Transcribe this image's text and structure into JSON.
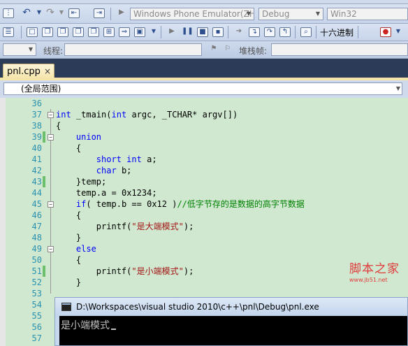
{
  "toolbar": {
    "platform_combo": "Windows Phone Emulator(ZH-",
    "config_combo": "Debug",
    "arch_combo": "Win32",
    "hex_label": "十六进制"
  },
  "debugbar": {
    "thread_label": "线程:",
    "stack_label": "堆栈帧:"
  },
  "tab": {
    "filename": "pnl.cpp",
    "close": "×"
  },
  "navbar": {
    "scope": "(全局范围)"
  },
  "editor": {
    "lines": [
      {
        "n": "36",
        "text": ""
      },
      {
        "n": "37",
        "text": "int _tmain(int argc, _TCHAR* argv[])"
      },
      {
        "n": "38",
        "text": "{"
      },
      {
        "n": "39",
        "text": "    union"
      },
      {
        "n": "40",
        "text": "    {"
      },
      {
        "n": "41",
        "text": "        short int a;"
      },
      {
        "n": "42",
        "text": "        char b;"
      },
      {
        "n": "43",
        "text": "    }temp;"
      },
      {
        "n": "44",
        "text": "    temp.a = 0x1234;"
      },
      {
        "n": "45",
        "text": "    if( temp.b == 0x12 )//低字节存的是数据的高字节数据"
      },
      {
        "n": "46",
        "text": "    {"
      },
      {
        "n": "47",
        "text": "        printf(\"是大端模式\");"
      },
      {
        "n": "48",
        "text": "    }"
      },
      {
        "n": "49",
        "text": "    else"
      },
      {
        "n": "50",
        "text": "    {"
      },
      {
        "n": "51",
        "text": "        printf(\"是小端模式\");"
      },
      {
        "n": "52",
        "text": "    }"
      },
      {
        "n": "53",
        "text": ""
      },
      {
        "n": "54",
        "text": ""
      },
      {
        "n": "55",
        "text": ""
      },
      {
        "n": "56",
        "text": ""
      },
      {
        "n": "57",
        "text": ""
      }
    ]
  },
  "watermark": {
    "name": "脚本之家",
    "url": "www.jb51.net"
  },
  "console": {
    "title": "D:\\Workspaces\\visual studio 2010\\c++\\pnl\\Debug\\pnl.exe",
    "output": "是小端模式"
  }
}
